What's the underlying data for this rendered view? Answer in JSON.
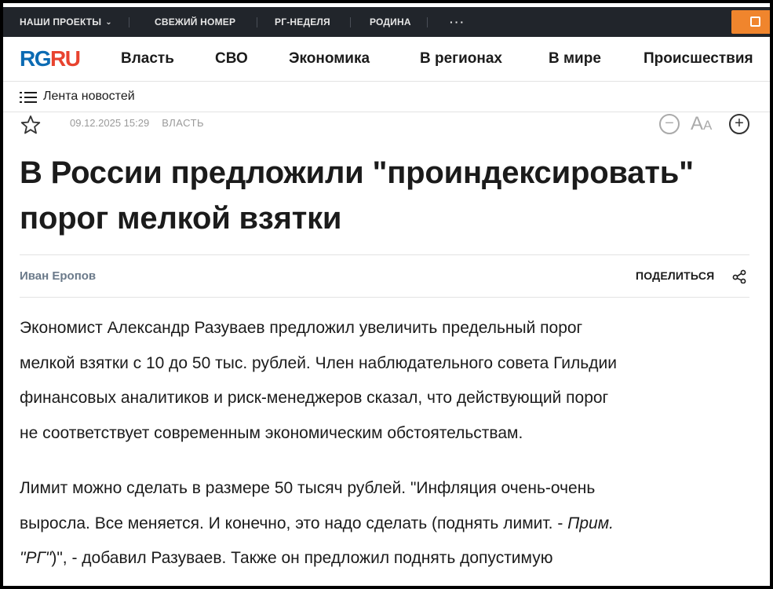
{
  "topbar": {
    "projects": "НАШИ ПРОЕКТЫ",
    "fresh_issue": "СВЕЖИЙ НОМЕР",
    "rg_week": "РГ-НЕДЕЛЯ",
    "rodina": "РОДИНА",
    "more": "···"
  },
  "logo": {
    "rg": "RG",
    "ru": "RU"
  },
  "nav": {
    "items": [
      "Власть",
      "СВО",
      "Экономика",
      "В регионах",
      "В мире",
      "Происшествия"
    ]
  },
  "feed": {
    "label": "Лента новостей"
  },
  "article": {
    "datetime": "09.12.2025 15:29",
    "rubric": "ВЛАСТЬ",
    "title_line1": "В России предложили \"проиндексировать\"",
    "title_line2": "порог мелкой взятки",
    "author": "Иван Еропов",
    "share": "ПОДЕЛИТЬСЯ",
    "font_size_label": "A",
    "font_size_small": "A",
    "p1_l1": "Экономист Александр Разуваев предложил увеличить предельный порог",
    "p1_l2": "мелкой взятки с 10 до 50 тыс. рублей. Член наблюдательного совета Гильдии",
    "p1_l3": "финансовых аналитиков и риск-менеджеров сказал, что действующий порог",
    "p1_l4": "не соответствует современным экономическим обстоятельствам.",
    "p2_l1": "Лимит можно сделать в размере 50 тысяч рублей. \"Инфляция очень-очень",
    "p2_l2a": "выросла. Все меняется. И конечно, это надо сделать (поднять лимит. - ",
    "p2_l2b": "Прим.",
    "p2_l3a": "\"РГ\"",
    "p2_l3b": ")\", - добавил Разуваев. Также он предложил поднять допустимую"
  },
  "colors": {
    "topbar_bg": "#21252b",
    "accent_orange": "#f0852d",
    "logo_blue": "#0c6bb3",
    "logo_red": "#e8432f"
  }
}
